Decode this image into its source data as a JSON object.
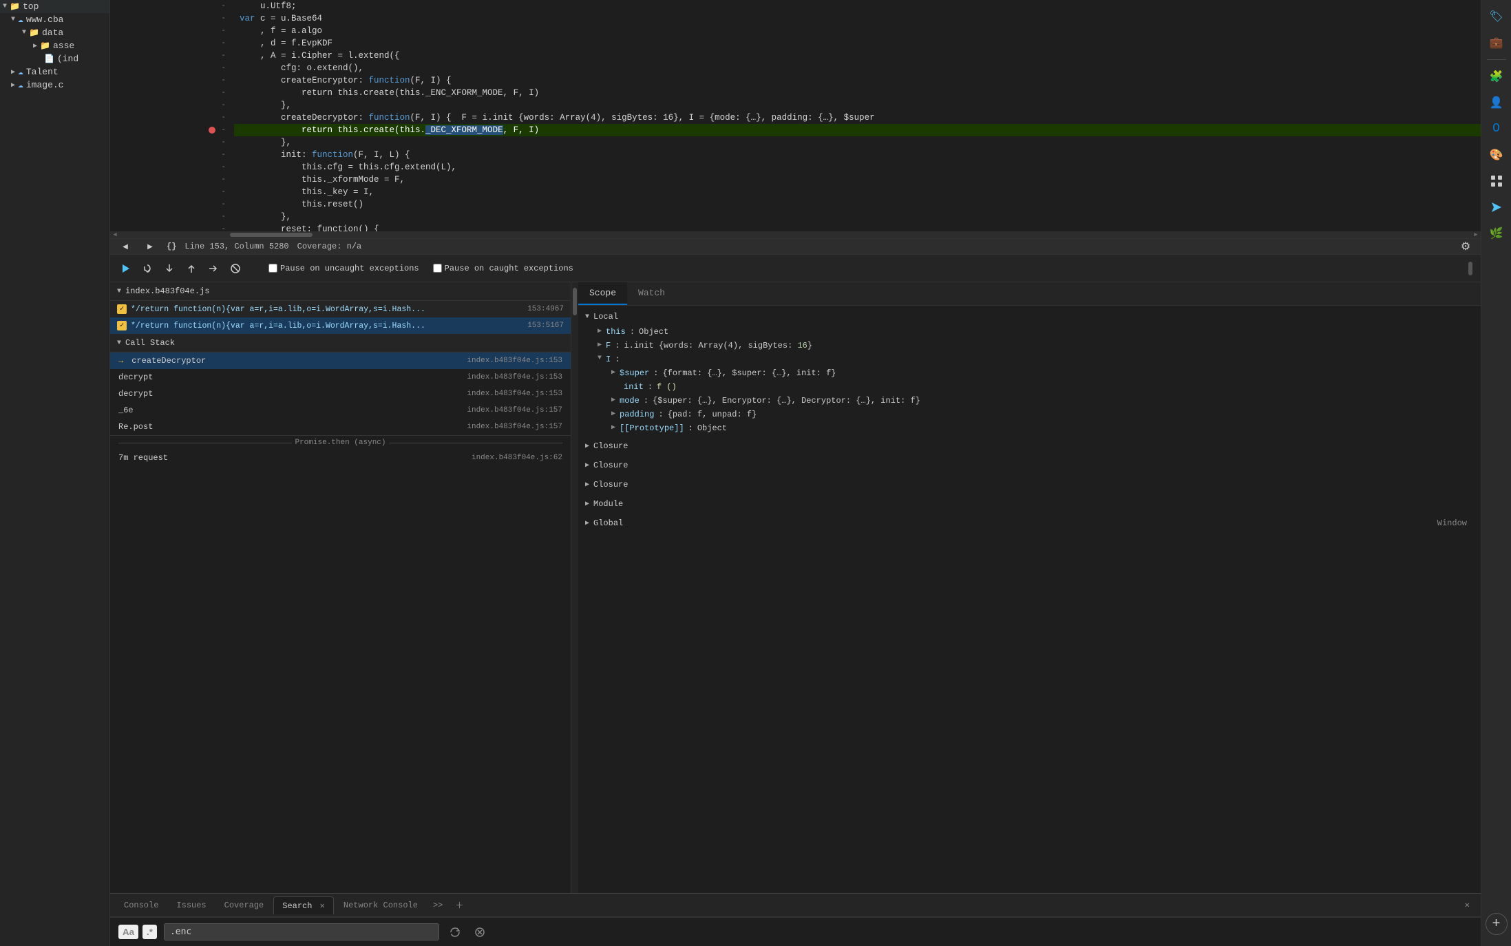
{
  "sidebar": {
    "items": [
      {
        "label": "top",
        "indent": 0,
        "type": "folder",
        "expanded": true
      },
      {
        "label": "www.cba",
        "indent": 1,
        "type": "cloud",
        "expanded": true
      },
      {
        "label": "data",
        "indent": 2,
        "type": "folder",
        "expanded": true
      },
      {
        "label": "asse",
        "indent": 3,
        "type": "folder"
      },
      {
        "label": "(ind",
        "indent": 3,
        "type": "file"
      },
      {
        "label": "Talent",
        "indent": 1,
        "type": "cloud"
      },
      {
        "label": "image.c",
        "indent": 1,
        "type": "cloud"
      }
    ]
  },
  "editor": {
    "status": {
      "braces": "{}",
      "position": "Line 153, Column 5280",
      "coverage": "Coverage: n/a"
    },
    "lines": [
      {
        "num": "",
        "minus": "-",
        "content": "u.Utf8;"
      },
      {
        "num": "",
        "minus": "-",
        "content": "var c = u.Base64"
      },
      {
        "num": "",
        "minus": "-",
        "content": "  , f = a.algo"
      },
      {
        "num": "",
        "minus": "-",
        "content": "  , d = f.EvpKDF"
      },
      {
        "num": "",
        "minus": "-",
        "content": "  , A = i.Cipher = l.extend({"
      },
      {
        "num": "",
        "minus": "-",
        "content": "      cfg: o.extend(),"
      },
      {
        "num": "",
        "minus": "-",
        "content": "      createEncryptor: function(F, I) {"
      },
      {
        "num": "",
        "minus": "-",
        "content": "          return this.create(this._ENC_XFORM_MODE, F, I)"
      },
      {
        "num": "",
        "minus": "-",
        "content": "      },"
      },
      {
        "num": "",
        "minus": "-",
        "content": "      createDecryptor: function(F, I) {  F = i.init {words: Array(4), sigBytes: 16}, I = {mode: {...}, padding: {...}, $super"
      },
      {
        "num": "",
        "minus": "-",
        "content": "          return this.create(this._DEC_XFORM_MODE, F, I)",
        "breakpoint": true,
        "highlighted": true
      },
      {
        "num": "",
        "minus": "-",
        "content": "      },"
      },
      {
        "num": "",
        "minus": "-",
        "content": "      init: function(F, I, L) {"
      },
      {
        "num": "",
        "minus": "-",
        "content": "          this.cfg = this.cfg.extend(L),"
      },
      {
        "num": "",
        "minus": "-",
        "content": "          this._xformMode = F,"
      },
      {
        "num": "",
        "minus": "-",
        "content": "          this._key = I,"
      },
      {
        "num": "",
        "minus": "-",
        "content": "          this.reset()"
      },
      {
        "num": "",
        "minus": "-",
        "content": "      },"
      },
      {
        "num": "",
        "minus": "-",
        "content": "      reset: function() {"
      }
    ]
  },
  "debugger": {
    "toolbar": {
      "resume": "▶",
      "step_over": "↷",
      "step_into": "↓",
      "step_out": "↑",
      "step": "→",
      "deactivate": "⊘"
    },
    "pause_labels": {
      "uncaught": "Pause on uncaught exceptions",
      "caught": "Pause on caught exceptions"
    },
    "breakpoints": {
      "header": "index.b483f04e.js",
      "items": [
        {
          "text": "*/return function(n){var a=r,i=a.lib,o=i.WordArray,s=i.Hash...",
          "location": "153:4967",
          "active": false
        },
        {
          "text": "*/return function(n){var a=r,i=a.lib,o=i.WordArray,s=i.Hash...",
          "location": "153:5167",
          "active": true
        }
      ]
    },
    "callstack": {
      "header": "Call Stack",
      "items": [
        {
          "name": "createDecryptor",
          "location": "index.b483f04e.js:153",
          "current": true
        },
        {
          "name": "decrypt",
          "location": "index.b483f04e.js:153",
          "current": false
        },
        {
          "name": "decrypt",
          "location": "index.b483f04e.js:153",
          "current": false
        },
        {
          "name": "_6e",
          "location": "index.b483f04e.js:157",
          "current": false
        },
        {
          "name": "Re.post",
          "location": "index.b483f04e.js:157",
          "current": false
        }
      ],
      "async_label": "Promise.then (async)",
      "more_items": [
        {
          "name": "7m request",
          "location": "index.b483f04e.js:62"
        }
      ]
    }
  },
  "scope": {
    "tabs": [
      "Scope",
      "Watch"
    ],
    "active_tab": "Scope",
    "local": {
      "header": "Local",
      "items": [
        {
          "key": "this",
          "value": "Object",
          "expandable": true
        },
        {
          "key": "F",
          "value": "i.init {words: Array(4), sigBytes: 16}",
          "expandable": true
        },
        {
          "key": "I",
          "value": "",
          "expandable": true,
          "expanded": true
        },
        {
          "key": "$super",
          "value": "{format: {…}, $super: {…}, init: f}",
          "expandable": true,
          "indent": 2
        },
        {
          "key": "init",
          "value": "f ()",
          "expandable": false,
          "indent": 2
        },
        {
          "key": "mode",
          "value": "{$super: {…}, Encryptor: {…}, Decryptor: {…}, init: f}",
          "expandable": true,
          "indent": 2
        },
        {
          "key": "padding",
          "value": "{pad: f, unpad: f}",
          "expandable": true,
          "indent": 2
        },
        {
          "key": "[[Prototype]]",
          "value": "Object",
          "expandable": false,
          "indent": 2
        }
      ]
    },
    "closures": [
      {
        "label": "Closure"
      },
      {
        "label": "Closure"
      },
      {
        "label": "Closure"
      }
    ],
    "module": {
      "label": "Module"
    },
    "global": {
      "label": "Global",
      "right_label": "Window"
    }
  },
  "bottom": {
    "tabs": [
      "Console",
      "Issues",
      "Coverage",
      "Search",
      "Network Console"
    ],
    "active_tab": "Search",
    "search": {
      "options": {
        "case_sensitive": "Aa",
        "regex": ".*"
      },
      "placeholder": ".enc",
      "value": ".enc"
    }
  },
  "chrome_sidebar": {
    "icons": [
      {
        "name": "bookmark-icon",
        "symbol": "🏷",
        "active": true
      },
      {
        "name": "briefcase-icon",
        "symbol": "💼"
      },
      {
        "name": "puzzle-icon",
        "symbol": "🧩"
      },
      {
        "name": "person-icon",
        "symbol": "👤"
      },
      {
        "name": "outlook-icon",
        "symbol": "📧"
      },
      {
        "name": "color-wheel-icon",
        "symbol": "🎨"
      },
      {
        "name": "apps-icon",
        "symbol": "⚡"
      },
      {
        "name": "send-icon",
        "symbol": "✈"
      },
      {
        "name": "leaf-icon",
        "symbol": "🌿"
      }
    ],
    "add_label": "+"
  }
}
